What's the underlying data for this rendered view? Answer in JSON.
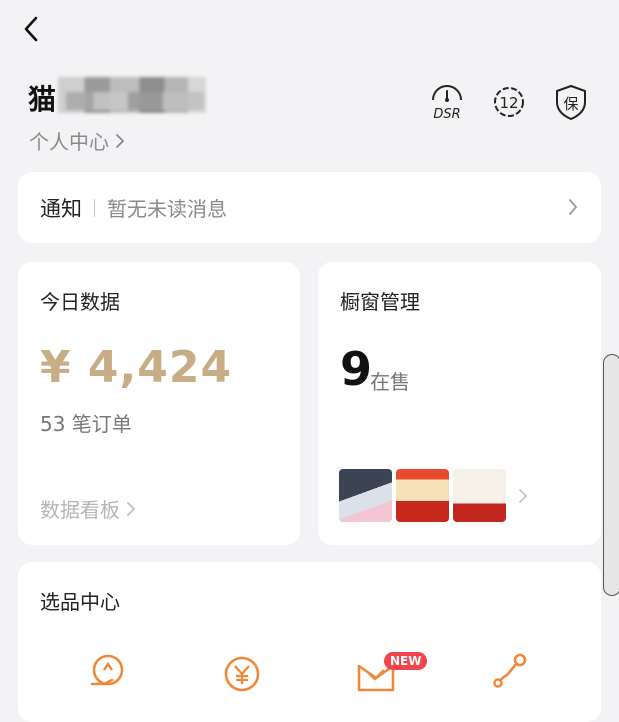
{
  "header": {
    "username": "猫",
    "personal_center": "个人中心",
    "icons": [
      "dsr-gauge-icon",
      "twelve-badge-icon",
      "guarantee-shield-icon"
    ],
    "dsr_label": "DSR",
    "badge_12": "12",
    "shield_char": "保"
  },
  "notice": {
    "label": "通知",
    "text": "暂无未读消息"
  },
  "today": {
    "title": "今日数据",
    "amount": "¥ 4,424",
    "orders": "53 笔订单",
    "dashboard_link": "数据看板"
  },
  "window": {
    "title": "橱窗管理",
    "count": "9",
    "count_label": "在售"
  },
  "pick_center": {
    "title": "选品中心",
    "new_badge": "NEW"
  },
  "colors": {
    "accent_gold": "#c7ad86",
    "badge_red": "#f2454b",
    "icon_orange": "#f0883a"
  }
}
